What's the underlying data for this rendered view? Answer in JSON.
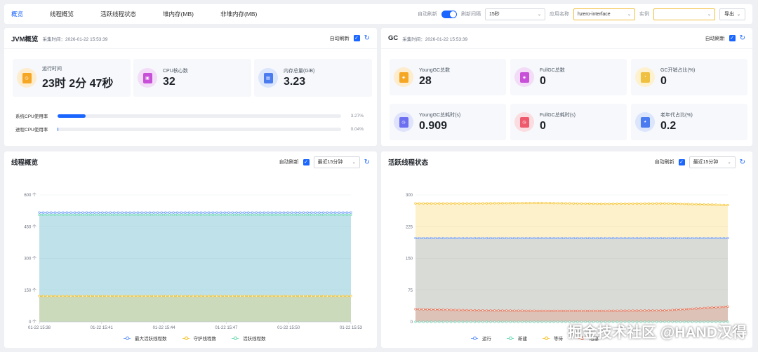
{
  "tabs": [
    "概览",
    "线程概览",
    "活跃线程状态",
    "堆内存(MB)",
    "非堆内存(MB)"
  ],
  "toolbar": {
    "auto_refresh_label": "自动刷新",
    "refresh_interval_label": "刷新间隔",
    "refresh_interval_value": "15秒",
    "app_name_label": "应用名称",
    "app_name_value": "hzero-interface",
    "instance_label": "实例",
    "instance_value": "",
    "export_label": "导出"
  },
  "jvm": {
    "title": "JVM概览",
    "collect_time": "采集时间：2026-01-22 15:53:39",
    "auto_refresh": "自动刷新",
    "metrics": [
      {
        "label": "运行时间",
        "value": "23时 2分 47秒",
        "icon": "runtime-icon"
      },
      {
        "label": "CPU核心数",
        "value": "32",
        "icon": "cpu-icon"
      },
      {
        "label": "内存总量(GiB)",
        "value": "3.23",
        "icon": "memory-icon"
      }
    ],
    "bars": [
      {
        "label": "系统CPU使用率",
        "pct": "3.27%",
        "value": 0.0327
      },
      {
        "label": "进程CPU使用率",
        "pct": "0.04%",
        "value": 0.0004
      }
    ]
  },
  "gc": {
    "title": "GC",
    "collect_time": "采集时间：2026-01-22 15:53:39",
    "auto_refresh": "自动刷新",
    "metrics": [
      {
        "label": "YoungGC总数",
        "value": "28",
        "icon": "young-gc-icon"
      },
      {
        "label": "FullGC总数",
        "value": "0",
        "icon": "full-gc-icon"
      },
      {
        "label": "GC开销占比(%)",
        "value": "0",
        "icon": "gc-overhead-icon"
      },
      {
        "label": "YoungGC总耗时(s)",
        "value": "0.909",
        "icon": "young-gc-time-icon"
      },
      {
        "label": "FullGC总耗时(s)",
        "value": "0",
        "icon": "full-gc-time-icon"
      },
      {
        "label": "老年代占比(%)",
        "value": "0.2",
        "icon": "old-gen-icon"
      }
    ]
  },
  "thread_panel": {
    "title": "线程概览",
    "auto_refresh": "自动刷新",
    "range": "最近15分钟"
  },
  "active_panel": {
    "title": "活跃线程状态",
    "auto_refresh": "自动刷新",
    "range": "最近15分钟"
  },
  "watermark": "掘金技术社区 @HAND汉得",
  "colors": {
    "accent": "#1a66ff",
    "blue": "#5b8ff9",
    "yellow": "#f6bd16",
    "green": "#5ad8a6",
    "red": "#e8684a",
    "gray": "#b8c4d6"
  },
  "chart_data": [
    {
      "type": "line",
      "title": "线程概览",
      "x": [
        "01-22 15:38",
        "01-22 15:41",
        "01-22 15:44",
        "01-22 15:47",
        "01-22 15:50",
        "01-22 15:53"
      ],
      "yticks": [
        "0 个",
        "150 个",
        "300 个",
        "450 个",
        "600 个"
      ],
      "ylim": [
        0,
        600
      ],
      "series": [
        {
          "name": "最大活跃线程数",
          "color": "#5b8ff9",
          "values": [
            517,
            517,
            517,
            517,
            517,
            517
          ]
        },
        {
          "name": "守护线程数",
          "color": "#f6bd16",
          "values": [
            122,
            122,
            122,
            122,
            122,
            122
          ]
        },
        {
          "name": "活跃线程数",
          "color": "#5ad8a6",
          "values": [
            506,
            506,
            506,
            506,
            506,
            506
          ]
        }
      ]
    },
    {
      "type": "line",
      "title": "活跃线程状态",
      "yticks": [
        "0",
        "75",
        "150",
        "225",
        "300"
      ],
      "ylim": [
        0,
        300
      ],
      "series": [
        {
          "name": "运行",
          "color": "#5b8ff9",
          "values": [
            198,
            198,
            198,
            198,
            198,
            198
          ]
        },
        {
          "name": "新建",
          "color": "#5ad8a6",
          "values": [
            0,
            0,
            0,
            0,
            0,
            0
          ]
        },
        {
          "name": "等待",
          "color": "#f6bd16",
          "values": [
            280,
            280,
            281,
            279,
            280,
            276
          ]
        },
        {
          "name": "阻塞",
          "color": "#e8684a",
          "values": [
            30,
            27,
            26,
            26,
            27,
            36
          ]
        }
      ]
    }
  ]
}
